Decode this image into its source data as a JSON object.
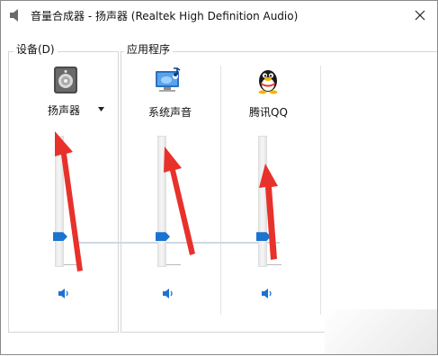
{
  "window": {
    "title": "音量合成器 - 扬声器 (Realtek High Definition Audio)"
  },
  "groups": {
    "device": "设备(D)",
    "apps": "应用程序"
  },
  "channels": [
    {
      "id": "speaker",
      "label": "扬声器",
      "icon": "speaker-device-icon",
      "volume_percent": 20,
      "muted": false
    },
    {
      "id": "system",
      "label": "系统声音",
      "icon": "system-sounds-icon",
      "volume_percent": 20,
      "muted": false
    },
    {
      "id": "qq",
      "label": "腾讯QQ",
      "icon": "qq-penguin-icon",
      "volume_percent": 20,
      "muted": false
    }
  ],
  "colors": {
    "accent": "#1b73d1",
    "annotation_arrow": "#e8312b"
  }
}
